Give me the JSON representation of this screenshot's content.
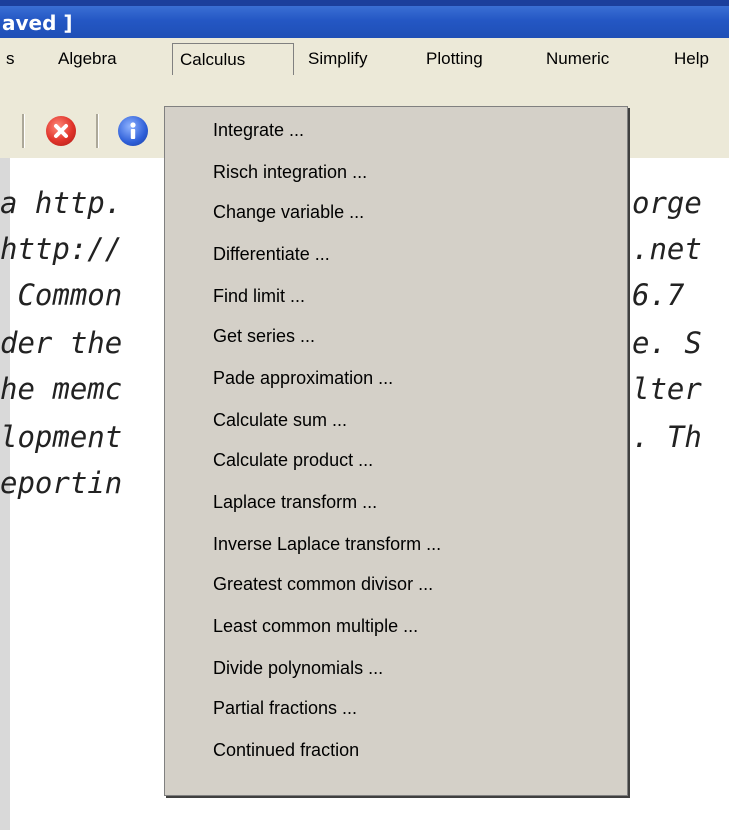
{
  "window": {
    "title": "aved ]"
  },
  "menubar": {
    "items": [
      "s",
      "Algebra",
      "Calculus",
      "Simplify",
      "Plotting",
      "Numeric",
      "Help"
    ],
    "active": "Calculus"
  },
  "toolbar": {
    "buttons": [
      {
        "icon": "stop-icon"
      },
      {
        "icon": "info-icon"
      }
    ]
  },
  "editor": {
    "lines_left": [
      "a http.",
      "http://",
      " Common",
      "der the",
      "he memc",
      "lopment",
      "eportin"
    ],
    "lines_right": [
      "orge",
      ".net",
      "6.7",
      "e. S",
      "lter",
      ". Th",
      ""
    ]
  },
  "calculus_menu": {
    "items": [
      "Integrate ...",
      "Risch integration ...",
      "Change variable ...",
      "Differentiate ...",
      "Find limit ...",
      "Get series ...",
      "Pade approximation ...",
      "Calculate sum ...",
      "Calculate product ...",
      "Laplace transform ...",
      "Inverse Laplace transform ...",
      "Greatest common divisor ...",
      "Least common multiple ...",
      "Divide polynomials ...",
      "Partial fractions ...",
      "Continued fraction"
    ]
  },
  "colors": {
    "titlebar": "#2457c4",
    "menu_bg": "#d4d0c8",
    "chrome_bg": "#ece9d8"
  }
}
